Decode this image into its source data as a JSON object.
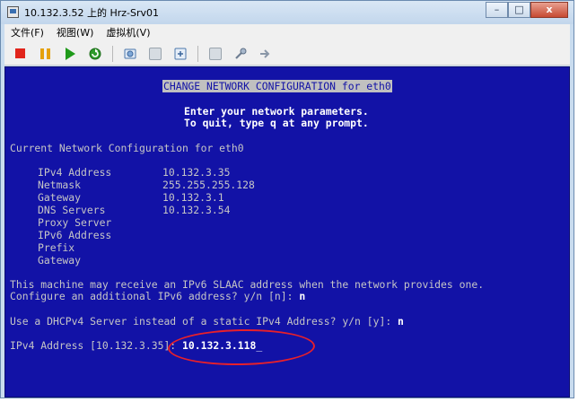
{
  "window": {
    "title": "10.132.3.52 上的 Hrz-Srv01",
    "minimize_label": "–",
    "maximize_label": "□",
    "close_label": "x"
  },
  "menu": {
    "items": [
      {
        "label": "文件(F)"
      },
      {
        "label": "视图(W)"
      },
      {
        "label": "虚拟机(V)"
      }
    ]
  },
  "toolbar": {
    "icons": [
      "stop-icon",
      "pause-icon",
      "play-icon",
      "reset-icon",
      "snapshot-icon",
      "revert-snapshot-icon",
      "manage-snapshot-icon",
      "console-icon",
      "settings-icon",
      "migrate-icon"
    ]
  },
  "console": {
    "heading": "CHANGE NETWORK CONFIGURATION for eth0",
    "intro_1": "Enter your network parameters.",
    "intro_2": "To quit, type q at any prompt.",
    "current_config_title": "Current Network Configuration for eth0",
    "fields": [
      {
        "label": "IPv4 Address",
        "value": "10.132.3.35"
      },
      {
        "label": "Netmask",
        "value": "255.255.255.128"
      },
      {
        "label": "Gateway",
        "value": "10.132.3.1"
      },
      {
        "label": "DNS Servers",
        "value": "10.132.3.54"
      },
      {
        "label": "Proxy Server",
        "value": ""
      },
      {
        "label": "IPv6 Address",
        "value": ""
      },
      {
        "label": "Prefix",
        "value": ""
      },
      {
        "label": "Gateway",
        "value": ""
      }
    ],
    "slaac_msg": "This machine may receive an IPv6 SLAAC address when the network provides one.",
    "ipv6_prompt": "Configure an additional IPv6 address? y/n [n]:",
    "ipv6_answer": "n",
    "dhcp_prompt": "Use a DHCPv4 Server instead of a static IPv4 Address? y/n [y]:",
    "dhcp_answer": "n",
    "ipv4_prompt": "IPv4 Address [10.132.3.35]:",
    "ipv4_input": "10.132.3.118",
    "cursor": "_"
  },
  "colors": {
    "console_bg": "#1212a6",
    "console_fg": "#c6c6c6",
    "annotation": "#e8202a"
  }
}
